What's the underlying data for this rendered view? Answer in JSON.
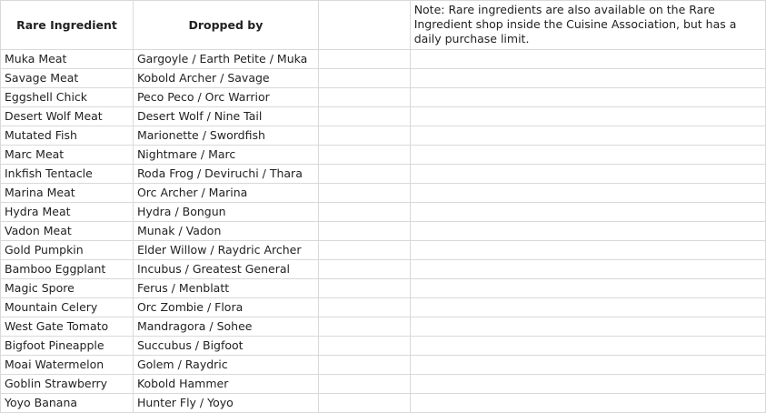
{
  "header": {
    "col_ingredient": "Rare Ingredient",
    "col_dropped_by": "Dropped by",
    "note": "Note: Rare ingredients are also available on the Rare Ingredient shop inside the Cuisine Association, but has a daily purchase limit."
  },
  "rows": [
    {
      "ingredient": "Muka Meat",
      "dropped_by": "Gargoyle / Earth Petite / Muka"
    },
    {
      "ingredient": "Savage Meat",
      "dropped_by": "Kobold Archer / Savage"
    },
    {
      "ingredient": "Eggshell Chick",
      "dropped_by": "Peco Peco / Orc Warrior"
    },
    {
      "ingredient": "Desert Wolf Meat",
      "dropped_by": "Desert Wolf / Nine Tail"
    },
    {
      "ingredient": "Mutated Fish",
      "dropped_by": "Marionette / Swordfish"
    },
    {
      "ingredient": "Marc Meat",
      "dropped_by": "Nightmare / Marc"
    },
    {
      "ingredient": "Inkfish Tentacle",
      "dropped_by": "Roda Frog / Deviruchi / Thara"
    },
    {
      "ingredient": "Marina Meat",
      "dropped_by": "Orc Archer / Marina"
    },
    {
      "ingredient": "Hydra Meat",
      "dropped_by": "Hydra / Bongun"
    },
    {
      "ingredient": "Vadon Meat",
      "dropped_by": "Munak / Vadon"
    },
    {
      "ingredient": "Gold Pumpkin",
      "dropped_by": "Elder Willow / Raydric Archer"
    },
    {
      "ingredient": "Bamboo Eggplant",
      "dropped_by": "Incubus / Greatest General"
    },
    {
      "ingredient": "Magic Spore",
      "dropped_by": "Ferus / Menblatt"
    },
    {
      "ingredient": "Mountain Celery",
      "dropped_by": "Orc Zombie / Flora"
    },
    {
      "ingredient": "West Gate Tomato",
      "dropped_by": "Mandragora / Sohee"
    },
    {
      "ingredient": "Bigfoot Pineapple",
      "dropped_by": "Succubus / Bigfoot"
    },
    {
      "ingredient": "Moai Watermelon",
      "dropped_by": "Golem / Raydric"
    },
    {
      "ingredient": "Goblin Strawberry",
      "dropped_by": "Kobold Hammer"
    },
    {
      "ingredient": "Yoyo Banana",
      "dropped_by": "Hunter Fly / Yoyo"
    }
  ]
}
